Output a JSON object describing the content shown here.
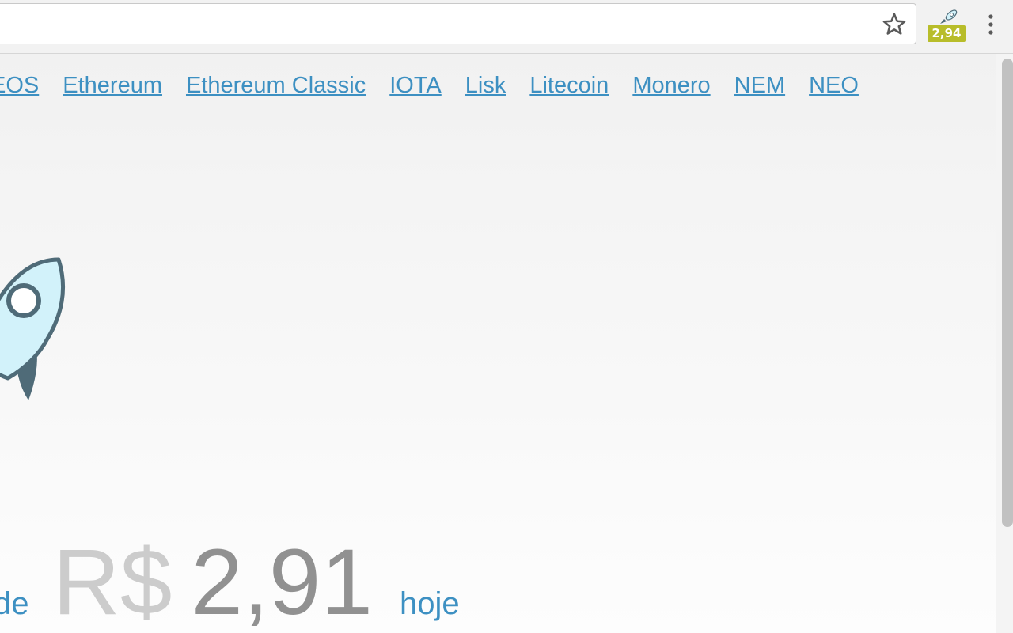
{
  "browser": {
    "extension_badge": "2,94",
    "icons": {
      "bookmark": "star-icon",
      "extension": "rocket-icon",
      "menu": "kebab-menu-icon"
    },
    "badge_color": "#b8bd2a"
  },
  "nav": {
    "links": [
      "EOS",
      "Ethereum",
      "Ethereum Classic",
      "IOTA",
      "Lisk",
      "Litecoin",
      "Monero",
      "NEM",
      "NEO"
    ],
    "link_color": "#3d90c2"
  },
  "price": {
    "prefix_word": "de",
    "currency": "R$",
    "amount": "2,91",
    "suffix_word": "hoje"
  },
  "logo": {
    "icon": "rocket-icon",
    "fill_color": "#d2f2fa",
    "stroke_color": "#4f6b78"
  }
}
